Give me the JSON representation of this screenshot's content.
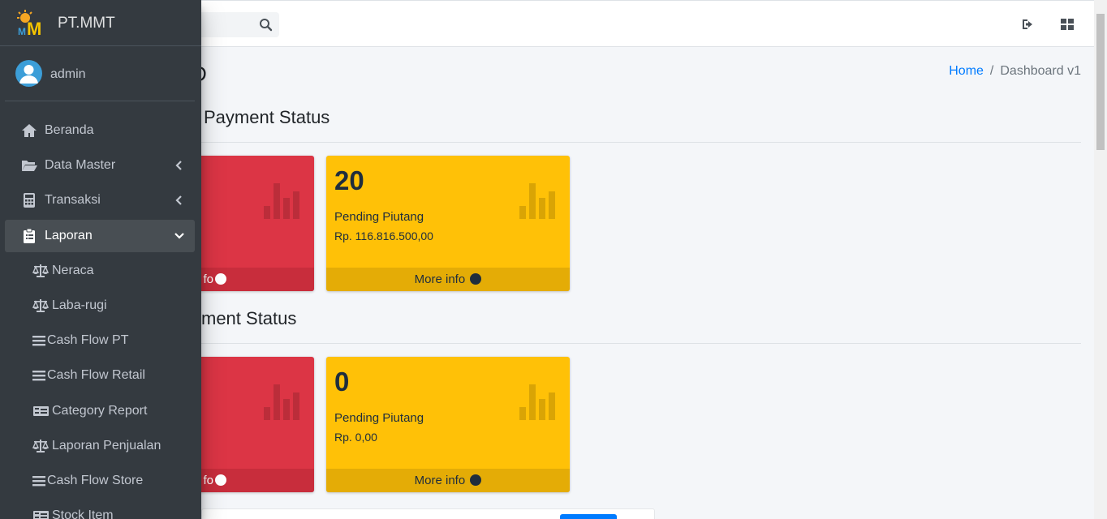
{
  "app": {
    "brand": "PT.MMT",
    "user": "admin"
  },
  "sidebar": {
    "items": [
      {
        "label": "Beranda",
        "icon": "home-icon"
      },
      {
        "label": "Data Master",
        "icon": "folder-open-icon"
      },
      {
        "label": "Transaksi",
        "icon": "calculator-icon"
      },
      {
        "label": "Laporan",
        "icon": "clipboard-list-icon"
      }
    ],
    "subitems": [
      {
        "label": "Neraca",
        "icon": "balance-scale-icon"
      },
      {
        "label": "Laba-rugi",
        "icon": "balance-scale-icon"
      },
      {
        "label": "Cash Flow PT",
        "icon": "bars-icon"
      },
      {
        "label": "Cash Flow Retail",
        "icon": "bars-icon"
      },
      {
        "label": "Category Report",
        "icon": "money-bill-icon"
      },
      {
        "label": "Laporan Penjualan",
        "icon": "balance-scale-icon"
      },
      {
        "label": "Cash Flow Store",
        "icon": "bars-icon"
      },
      {
        "label": "Stock Item",
        "icon": "money-bill-icon"
      }
    ]
  },
  "header": {
    "title_partial": "D",
    "breadcrumb": {
      "home": "Home",
      "separator": "/",
      "current": "Dashboard v1"
    }
  },
  "sections": [
    {
      "title_partial": "Payment Status",
      "boxes": [
        {
          "color": "red",
          "number": "",
          "label": "",
          "amount": "",
          "footer_partial": "fo"
        },
        {
          "color": "yellow",
          "number": "20",
          "label": "Pending Piutang",
          "amount": "Rp. 116.816.500,00",
          "footer": "More info"
        }
      ]
    },
    {
      "title_partial": "ment Status",
      "boxes": [
        {
          "color": "red",
          "number": "",
          "label": "",
          "amount": "",
          "footer_partial": "fo"
        },
        {
          "color": "yellow",
          "number": "0",
          "label": "Pending Piutang",
          "amount": "Rp. 0,00",
          "footer": "More info"
        }
      ]
    }
  ],
  "colors": {
    "sidebar_bg": "#343a40",
    "danger": "#dc3545",
    "warning": "#ffc107",
    "primary": "#007bff"
  }
}
